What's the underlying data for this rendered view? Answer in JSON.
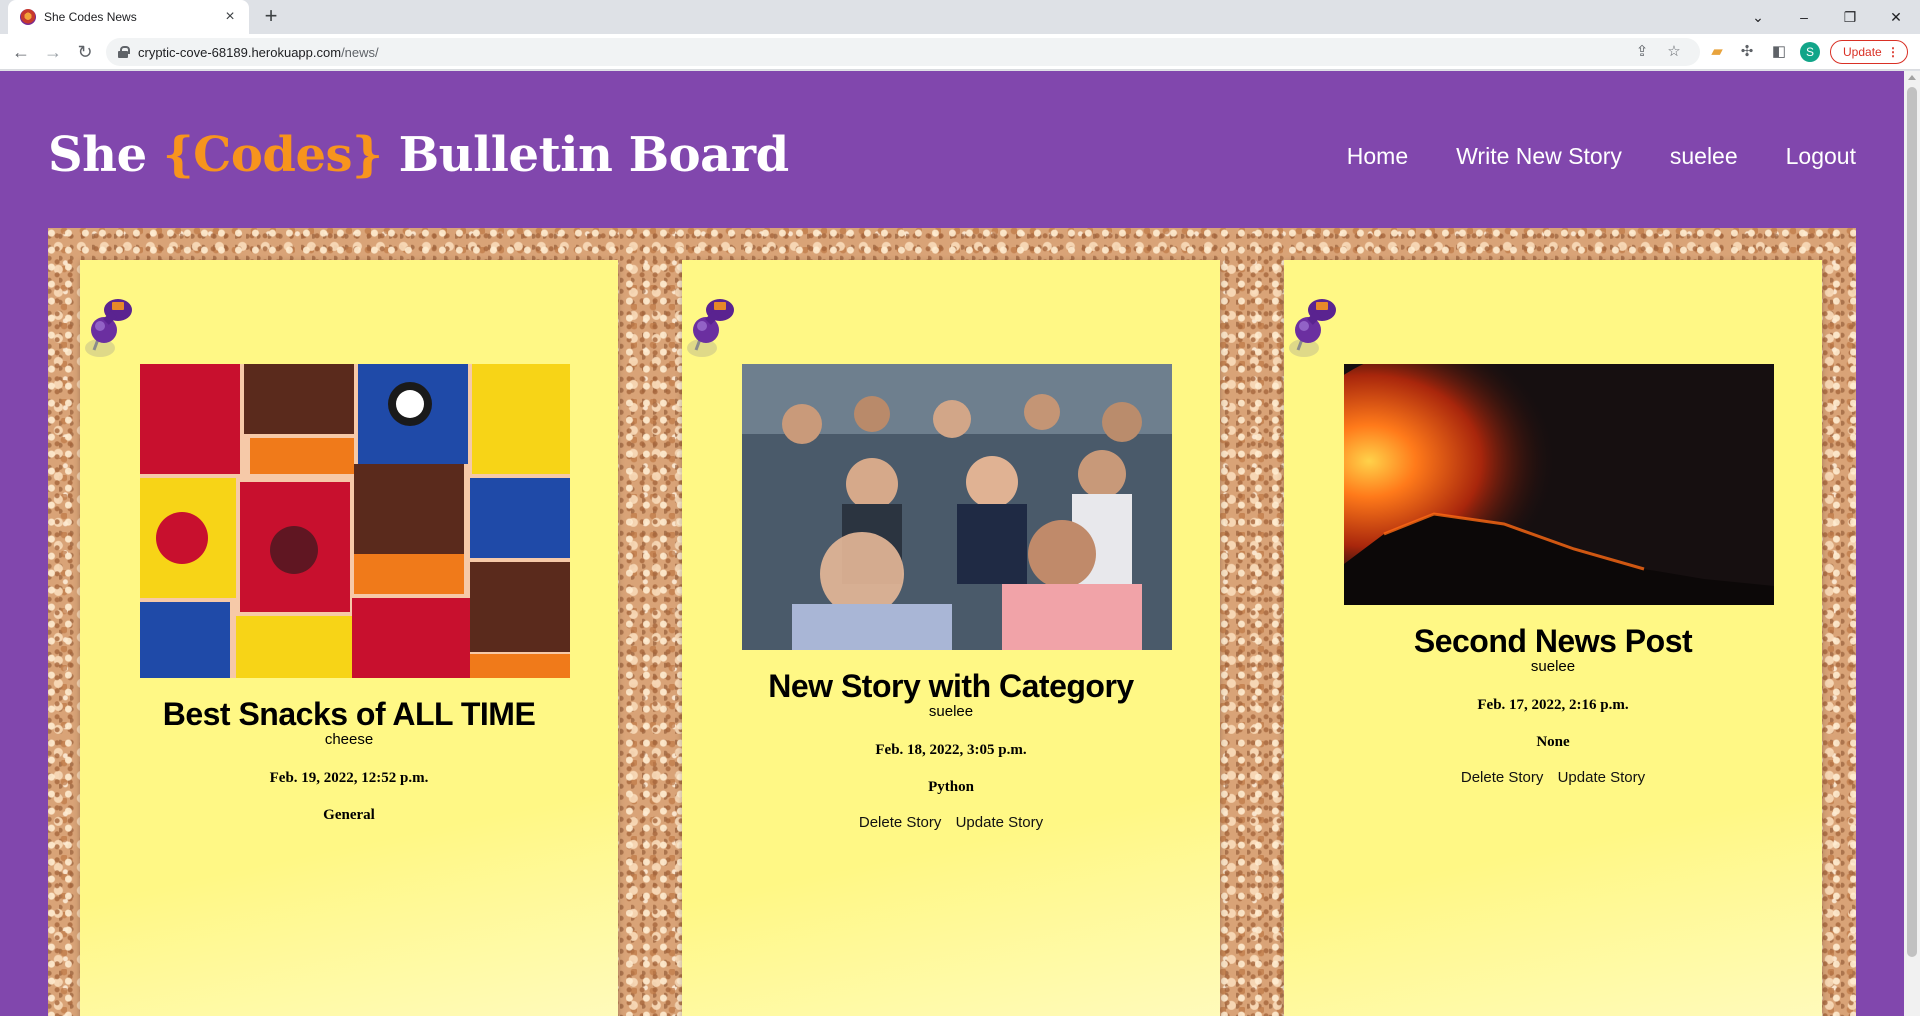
{
  "browser": {
    "tab_title": "She Codes News",
    "url_host": "cryptic-cove-68189.herokuapp.com",
    "url_path": "/news/",
    "profile_initial": "S",
    "update_label": "Update"
  },
  "site": {
    "title_pre": "She ",
    "title_accent": "{Codes}",
    "title_post": " Bulletin Board",
    "accent_color": "#f7941d",
    "header_color": "#8147ad",
    "card_color": "#fff885"
  },
  "nav": {
    "items": [
      {
        "label": "Home"
      },
      {
        "label": "Write New Story"
      },
      {
        "label": "suelee"
      },
      {
        "label": "Logout"
      }
    ]
  },
  "stories": [
    {
      "title": "Best Snacks of ALL TIME",
      "author": "cheese",
      "date": "Feb. 19, 2022, 12:52 p.m.",
      "category": "General",
      "image": "snack-bags-photo",
      "actions": []
    },
    {
      "title": "New Story with Category",
      "author": "suelee",
      "date": "Feb. 18, 2022, 3:05 p.m.",
      "category": "Python",
      "image": "audience-photo",
      "actions": [
        "Delete Story",
        "Update Story"
      ]
    },
    {
      "title": "Second News Post",
      "author": "suelee",
      "date": "Feb. 17, 2022, 2:16 p.m.",
      "category": "None",
      "image": "volcano-photo",
      "actions": [
        "Delete Story",
        "Update Story"
      ]
    }
  ]
}
